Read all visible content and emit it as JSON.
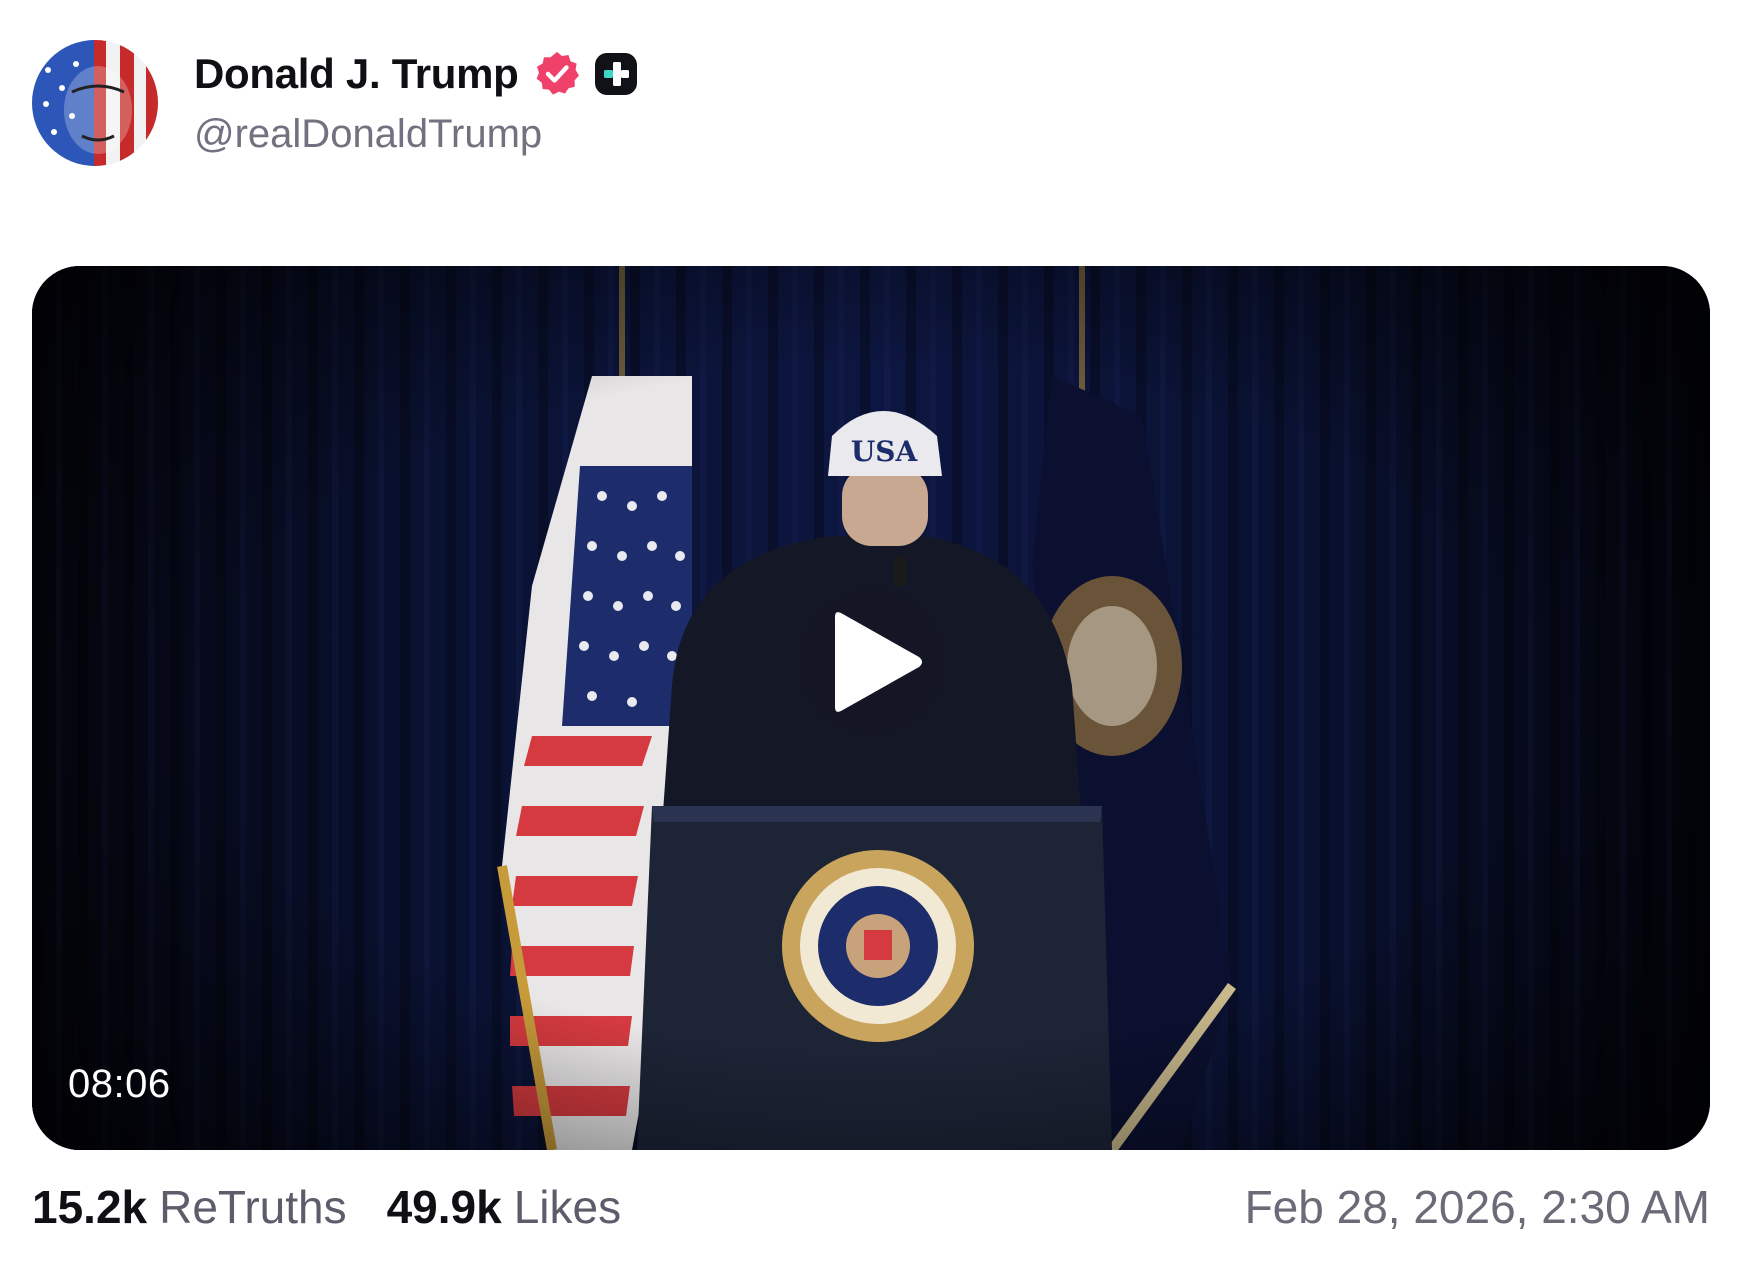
{
  "author": {
    "display_name": "Donald J. Trump",
    "handle": "@realDonaldTrump",
    "verified_icon": "verified-badge-icon",
    "badge_icon": "truth-plus-icon"
  },
  "video": {
    "duration": "08:06",
    "play_icon": "play-icon"
  },
  "stats": {
    "retruths_count": "15.2k",
    "retruths_label": "ReTruths",
    "likes_count": "49.9k",
    "likes_label": "Likes"
  },
  "timestamp": "Feb 28, 2026, 2:30 AM",
  "colors": {
    "verified": "#f0416a",
    "badge_bg": "#111118",
    "badge_accent": "#3fd6c8",
    "muted_text": "#71717f"
  }
}
